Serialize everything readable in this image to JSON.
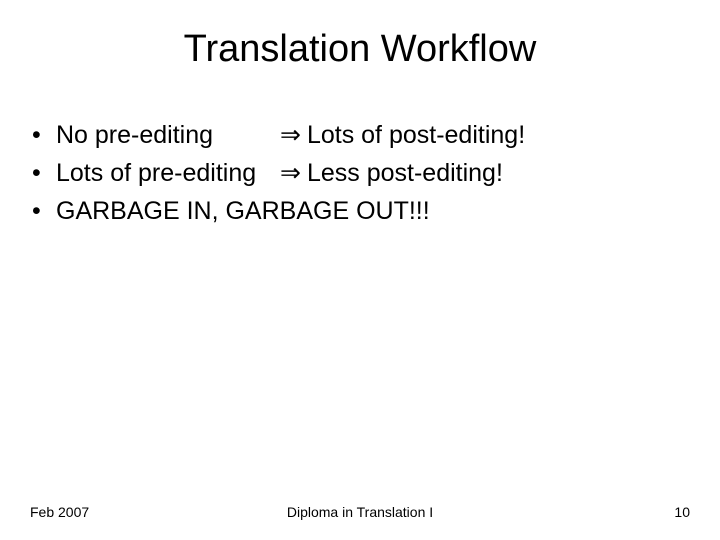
{
  "title": "Translation Workflow",
  "bullets": [
    {
      "left": "No pre-editing",
      "leftWidth": "218px",
      "arrow": "⇒",
      "right": "Lots of post-editing!"
    },
    {
      "left": "Lots of pre-editing",
      "leftWidth": "218px",
      "arrow": "⇒",
      "right": "Less post-editing!"
    },
    {
      "full": "GARBAGE IN, GARBAGE OUT!!!"
    }
  ],
  "footer": {
    "left": "Feb 2007",
    "center": "Diploma in Translation I",
    "right": "10"
  }
}
